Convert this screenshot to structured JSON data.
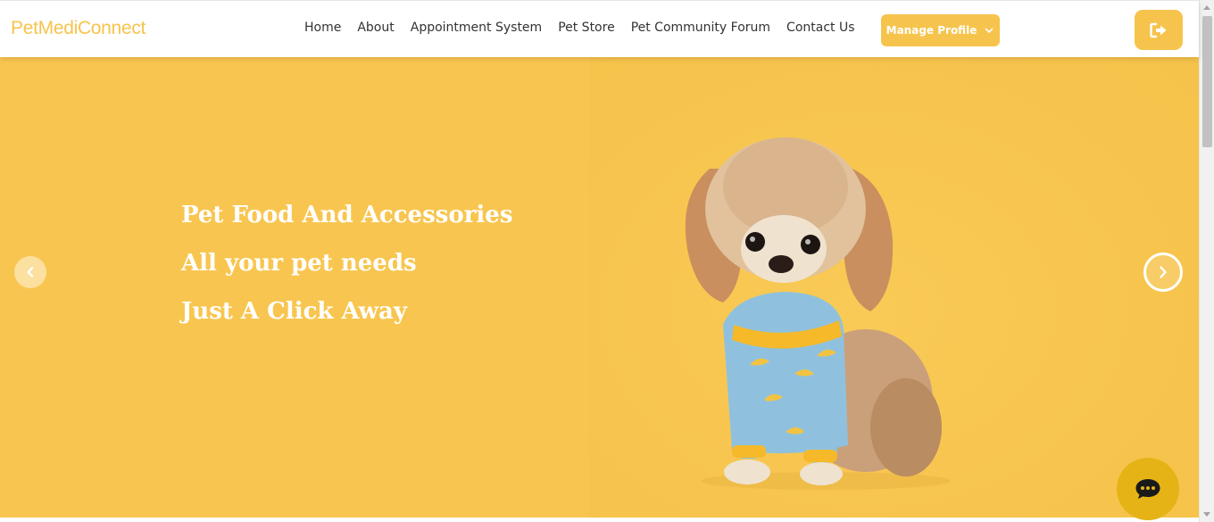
{
  "navbar": {
    "brand": "PetMediConnect",
    "links": [
      "Home",
      "About",
      "Appointment System",
      "Pet Store",
      "Pet Community Forum",
      "Contact Us"
    ],
    "manage_profile_label": "Manage Profile",
    "logout_icon": "sign-out-icon"
  },
  "hero": {
    "lines": [
      "Pet Food And Accessories",
      "All your pet needs",
      "Just A Click Away"
    ],
    "prev_icon": "chevron-left-icon",
    "next_icon": "chevron-right-icon",
    "image": "dog-in-banana-pajamas"
  },
  "chat": {
    "icon": "chat-bubble-icon"
  },
  "colors": {
    "accent": "#f6c44d",
    "hero_background": "#f8c650",
    "chat_button": "#e6b317",
    "brand_text": "#f6c44d"
  }
}
